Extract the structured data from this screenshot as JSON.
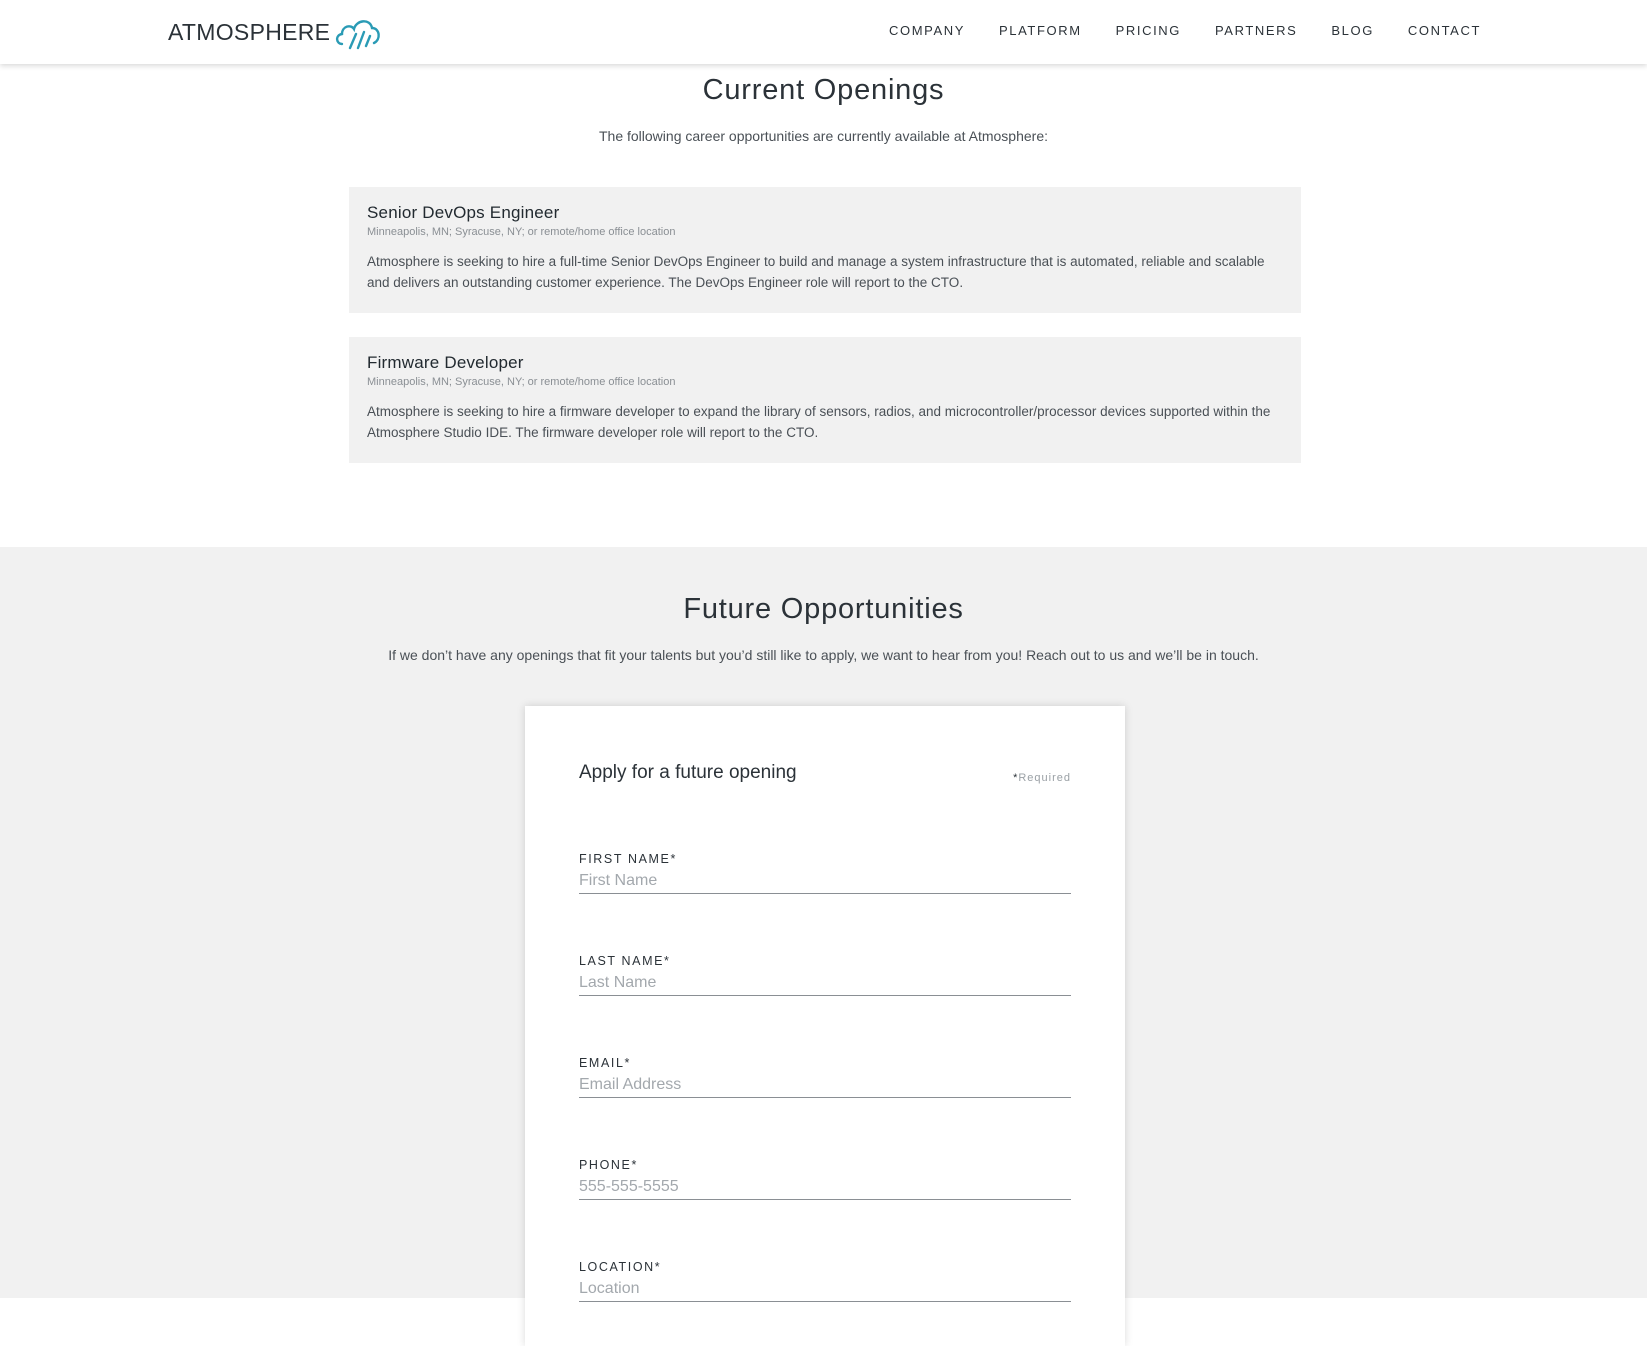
{
  "header": {
    "logo_text": "ATMOSPHERE",
    "nav": [
      "COMPANY",
      "PLATFORM",
      "PRICING",
      "PARTNERS",
      "BLOG",
      "CONTACT"
    ]
  },
  "openings": {
    "title": "Current Openings",
    "intro": "The following career opportunities are currently available at Atmosphere:",
    "jobs": [
      {
        "title": "Senior DevOps Engineer",
        "location": "Minneapolis, MN; Syracuse, NY; or remote/home office location",
        "description": "Atmosphere is seeking to hire a full-time Senior DevOps Engineer to build and manage a system infrastructure that is automated, reliable and scalable and delivers an outstanding customer experience.  The DevOps Engineer role will report to the CTO."
      },
      {
        "title": "Firmware Developer",
        "location": "Minneapolis, MN; Syracuse, NY; or remote/home office location",
        "description": "Atmosphere is seeking to hire a firmware developer to expand the library of sensors, radios, and microcontroller/processor devices supported within the Atmosphere Studio IDE. The firmware developer role will report to the CTO."
      }
    ]
  },
  "future": {
    "title": "Future Opportunities",
    "intro": "If we don’t have any openings that fit your talents but you’d still like to apply, we want to hear from you! Reach out to us and we’ll be in touch.",
    "form": {
      "title": "Apply for a future opening",
      "required_star": "*",
      "required_text": "Required",
      "fields": [
        {
          "label": "FIRST NAME*",
          "placeholder": "First Name",
          "value": ""
        },
        {
          "label": "LAST NAME*",
          "placeholder": "Last Name",
          "value": ""
        },
        {
          "label": "EMAIL*",
          "placeholder": "Email Address",
          "value": ""
        },
        {
          "label": "PHONE*",
          "placeholder": "555-555-5555",
          "value": ""
        },
        {
          "label": "LOCATION*",
          "placeholder": "Location",
          "value": ""
        }
      ]
    }
  },
  "colors": {
    "brand_teal": "#2a9bb5",
    "text_dark": "#2b3238",
    "panel_gray": "#f1f1f1"
  }
}
